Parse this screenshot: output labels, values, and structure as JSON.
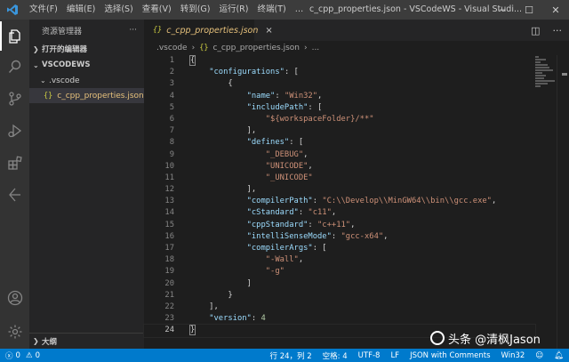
{
  "titlebar": {
    "menus": [
      "文件(F)",
      "编辑(E)",
      "选择(S)",
      "查看(V)",
      "转到(G)",
      "运行(R)",
      "终端(T)",
      "…"
    ],
    "window_title": "c_cpp_properties.json - VSCodeWS - Visual Studi..."
  },
  "sidebar": {
    "title": "资源管理器",
    "more": "···",
    "open_editors": "打开的编辑器",
    "workspace": "VSCODEWS",
    "folder": ".vscode",
    "file": "c_cpp_properties.json",
    "outline": "大纲"
  },
  "tab": {
    "icon": "{}",
    "label": "c_cpp_properties.json",
    "close": "×"
  },
  "breadcrumb": {
    "folder": ".vscode",
    "icon": "{}",
    "file": "c_cpp_properties.json",
    "more": "..."
  },
  "editor": {
    "current_line": 24,
    "lines": [
      [
        {
          "t": "{",
          "c": "p"
        }
      ],
      [
        {
          "t": "    ",
          "c": "p"
        },
        {
          "t": "\"configurations\"",
          "c": "k"
        },
        {
          "t": ": [",
          "c": "p"
        }
      ],
      [
        {
          "t": "        {",
          "c": "p"
        }
      ],
      [
        {
          "t": "            ",
          "c": "p"
        },
        {
          "t": "\"name\"",
          "c": "k"
        },
        {
          "t": ": ",
          "c": "p"
        },
        {
          "t": "\"Win32\"",
          "c": "s"
        },
        {
          "t": ",",
          "c": "p"
        }
      ],
      [
        {
          "t": "            ",
          "c": "p"
        },
        {
          "t": "\"includePath\"",
          "c": "k"
        },
        {
          "t": ": [",
          "c": "p"
        }
      ],
      [
        {
          "t": "                ",
          "c": "p"
        },
        {
          "t": "\"${workspaceFolder}/**\"",
          "c": "s"
        }
      ],
      [
        {
          "t": "            ],",
          "c": "p"
        }
      ],
      [
        {
          "t": "            ",
          "c": "p"
        },
        {
          "t": "\"defines\"",
          "c": "k"
        },
        {
          "t": ": [",
          "c": "p"
        }
      ],
      [
        {
          "t": "                ",
          "c": "p"
        },
        {
          "t": "\"_DEBUG\"",
          "c": "s"
        },
        {
          "t": ",",
          "c": "p"
        }
      ],
      [
        {
          "t": "                ",
          "c": "p"
        },
        {
          "t": "\"UNICODE\"",
          "c": "s"
        },
        {
          "t": ",",
          "c": "p"
        }
      ],
      [
        {
          "t": "                ",
          "c": "p"
        },
        {
          "t": "\"_UNICODE\"",
          "c": "s"
        }
      ],
      [
        {
          "t": "            ],",
          "c": "p"
        }
      ],
      [
        {
          "t": "            ",
          "c": "p"
        },
        {
          "t": "\"compilerPath\"",
          "c": "k"
        },
        {
          "t": ": ",
          "c": "p"
        },
        {
          "t": "\"C:\\\\Develop\\\\MinGW64\\\\bin\\\\gcc.exe\"",
          "c": "s"
        },
        {
          "t": ",",
          "c": "p"
        }
      ],
      [
        {
          "t": "            ",
          "c": "p"
        },
        {
          "t": "\"cStandard\"",
          "c": "k"
        },
        {
          "t": ": ",
          "c": "p"
        },
        {
          "t": "\"c11\"",
          "c": "s"
        },
        {
          "t": ",",
          "c": "p"
        }
      ],
      [
        {
          "t": "            ",
          "c": "p"
        },
        {
          "t": "\"cppStandard\"",
          "c": "k"
        },
        {
          "t": ": ",
          "c": "p"
        },
        {
          "t": "\"c++11\"",
          "c": "s"
        },
        {
          "t": ",",
          "c": "p"
        }
      ],
      [
        {
          "t": "            ",
          "c": "p"
        },
        {
          "t": "\"intelliSenseMode\"",
          "c": "k"
        },
        {
          "t": ": ",
          "c": "p"
        },
        {
          "t": "\"gcc-x64\"",
          "c": "s"
        },
        {
          "t": ",",
          "c": "p"
        }
      ],
      [
        {
          "t": "            ",
          "c": "p"
        },
        {
          "t": "\"compilerArgs\"",
          "c": "k"
        },
        {
          "t": ": [",
          "c": "p"
        }
      ],
      [
        {
          "t": "                ",
          "c": "p"
        },
        {
          "t": "\"-Wall\"",
          "c": "s"
        },
        {
          "t": ",",
          "c": "p"
        }
      ],
      [
        {
          "t": "                ",
          "c": "p"
        },
        {
          "t": "\"-g\"",
          "c": "s"
        }
      ],
      [
        {
          "t": "            ]",
          "c": "p"
        }
      ],
      [
        {
          "t": "        }",
          "c": "p"
        }
      ],
      [
        {
          "t": "    ],",
          "c": "p"
        }
      ],
      [
        {
          "t": "    ",
          "c": "p"
        },
        {
          "t": "\"version\"",
          "c": "k"
        },
        {
          "t": ": ",
          "c": "p"
        },
        {
          "t": "4",
          "c": "n"
        }
      ],
      [
        {
          "t": "}",
          "c": "p"
        }
      ]
    ]
  },
  "statusbar": {
    "errors": "0",
    "warnings": "0",
    "position": "行 24，列 2",
    "spaces": "空格: 4",
    "encoding": "UTF-8",
    "eol": "LF",
    "language": "JSON with Comments",
    "config": "Win32"
  },
  "watermark": "头条 @清枫Jason",
  "colors": {
    "accent": "#007acc",
    "string": "#ce9178",
    "key": "#9cdcfe",
    "number": "#b5cea8",
    "modified_file": "#e5c07b"
  }
}
